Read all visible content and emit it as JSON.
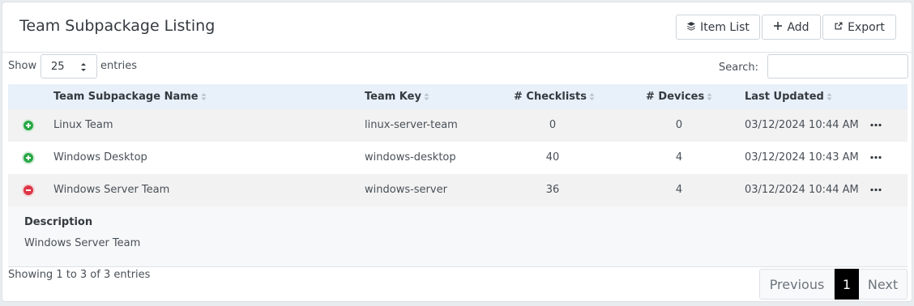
{
  "header": {
    "title": "Team Subpackage Listing",
    "buttons": {
      "item_list": "Item List",
      "add": "Add",
      "export": "Export"
    }
  },
  "controls": {
    "show_label": "Show",
    "page_size": "25",
    "entries_label": "entries",
    "search_label": "Search:",
    "search_value": ""
  },
  "table": {
    "columns": [
      "Team Subpackage Name",
      "Team Key",
      "# Checklists",
      "# Devices",
      "Last Updated"
    ],
    "rows": [
      {
        "name": "Linux Team",
        "key": "linux-server-team",
        "checklists": "0",
        "devices": "0",
        "updated": "03/12/2024 10:44 AM",
        "expanded": false
      },
      {
        "name": "Windows Desktop",
        "key": "windows-desktop",
        "checklists": "40",
        "devices": "4",
        "updated": "03/12/2024 10:43 AM",
        "expanded": false
      },
      {
        "name": "Windows Server Team",
        "key": "windows-server",
        "checklists": "36",
        "devices": "4",
        "updated": "03/12/2024 10:44 AM",
        "expanded": true
      }
    ],
    "detail": {
      "title": "Description",
      "text": "Windows Server Team"
    }
  },
  "footer": {
    "info": "Showing 1 to 3 of 3 entries",
    "pager": {
      "previous": "Previous",
      "current": "1",
      "next": "Next"
    }
  },
  "colors": {
    "header_bg": "#e8f0f9",
    "expand_icon": "#28a745",
    "collapse_icon": "#dc3545",
    "current_page_bg": "#000000"
  }
}
